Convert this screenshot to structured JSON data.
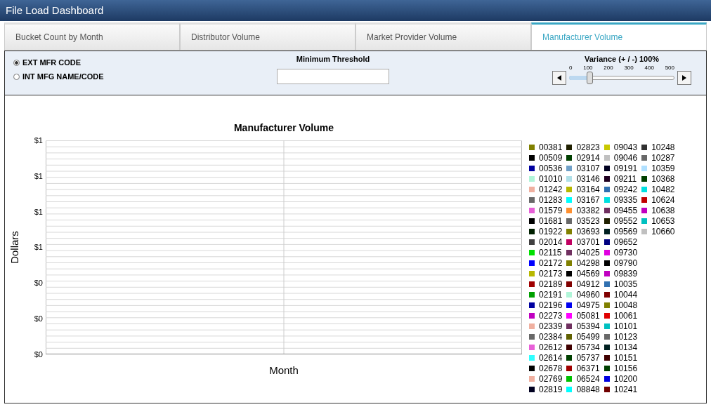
{
  "window": {
    "title": "File Load Dashboard"
  },
  "tabs": [
    {
      "label": "Bucket Count by Month",
      "selected": false
    },
    {
      "label": "Distributor Volume",
      "selected": false
    },
    {
      "label": "Market Provider Volume",
      "selected": false
    },
    {
      "label": "Manufacturer Volume",
      "selected": true
    }
  ],
  "options": [
    {
      "label": "EXT MFR CODE",
      "selected": true
    },
    {
      "label": "INT MFG NAME/CODE",
      "selected": false
    }
  ],
  "threshold": {
    "label": "Minimum Threshold"
  },
  "variance": {
    "label": "Variance (+ / -) 100%",
    "ticks": [
      "0",
      "100",
      "200",
      "300",
      "400",
      "500"
    ],
    "level": 0.2
  },
  "chart": {
    "title": "Manufacturer Volume",
    "xlabel": "Month",
    "ylabel": "Dollars",
    "ytick_labels": [
      "$1",
      "$1",
      "$1",
      "$1",
      "$0",
      "$0",
      "$0"
    ],
    "legend": [
      {
        "label": "00381",
        "color": "#808000"
      },
      {
        "label": "00509",
        "color": "#000000"
      },
      {
        "label": "00536",
        "color": "#0000a0"
      },
      {
        "label": "01010",
        "color": "#b0f5d8"
      },
      {
        "label": "01242",
        "color": "#f0b0a0"
      },
      {
        "label": "01283",
        "color": "#686868"
      },
      {
        "label": "01579",
        "color": "#e860d8"
      },
      {
        "label": "01681",
        "color": "#000000"
      },
      {
        "label": "01922",
        "color": "#002000"
      },
      {
        "label": "02014",
        "color": "#404040"
      },
      {
        "label": "02115",
        "color": "#00e000"
      },
      {
        "label": "02172",
        "color": "#0000ff"
      },
      {
        "label": "02173",
        "color": "#b8b800"
      },
      {
        "label": "02189",
        "color": "#a00000"
      },
      {
        "label": "02191",
        "color": "#00a000"
      },
      {
        "label": "02196",
        "color": "#0000a0"
      },
      {
        "label": "02273",
        "color": "#c000c0"
      },
      {
        "label": "02339",
        "color": "#f0b0a0"
      },
      {
        "label": "02384",
        "color": "#686868"
      },
      {
        "label": "02612",
        "color": "#e860d8"
      },
      {
        "label": "02614",
        "color": "#30ffff"
      },
      {
        "label": "02678",
        "color": "#000000"
      },
      {
        "label": "02769",
        "color": "#f0b0a0"
      },
      {
        "label": "02819",
        "color": "#000020"
      },
      {
        "label": "02823",
        "color": "#202000"
      },
      {
        "label": "02914",
        "color": "#004000"
      },
      {
        "label": "03107",
        "color": "#70a0c8"
      },
      {
        "label": "03146",
        "color": "#b0e0e8"
      },
      {
        "label": "03164",
        "color": "#b8b800"
      },
      {
        "label": "03167",
        "color": "#00ffff"
      },
      {
        "label": "03382",
        "color": "#ff9030"
      },
      {
        "label": "03523",
        "color": "#686868"
      },
      {
        "label": "03693",
        "color": "#808000"
      },
      {
        "label": "03701",
        "color": "#c00060"
      },
      {
        "label": "04025",
        "color": "#703060"
      },
      {
        "label": "04298",
        "color": "#808000"
      },
      {
        "label": "04569",
        "color": "#000000"
      },
      {
        "label": "04912",
        "color": "#800000"
      },
      {
        "label": "04960",
        "color": "#b0f5d8"
      },
      {
        "label": "04975",
        "color": "#0000f0"
      },
      {
        "label": "05081",
        "color": "#ff00ff"
      },
      {
        "label": "05394",
        "color": "#703060"
      },
      {
        "label": "05499",
        "color": "#606000"
      },
      {
        "label": "05734",
        "color": "#400000"
      },
      {
        "label": "05737",
        "color": "#004000"
      },
      {
        "label": "06371",
        "color": "#a00000"
      },
      {
        "label": "06524",
        "color": "#00c000"
      },
      {
        "label": "08848",
        "color": "#00ffff"
      },
      {
        "label": "09043",
        "color": "#c8c800"
      },
      {
        "label": "09046",
        "color": "#c0c0c0"
      },
      {
        "label": "09191",
        "color": "#000020"
      },
      {
        "label": "09211",
        "color": "#200020"
      },
      {
        "label": "09242",
        "color": "#3070b0"
      },
      {
        "label": "09335",
        "color": "#00e0e0"
      },
      {
        "label": "09455",
        "color": "#703060"
      },
      {
        "label": "09552",
        "color": "#202000"
      },
      {
        "label": "09569",
        "color": "#002020"
      },
      {
        "label": "09652",
        "color": "#000080"
      },
      {
        "label": "09730",
        "color": "#e000e0"
      },
      {
        "label": "09790",
        "color": "#000000"
      },
      {
        "label": "09839",
        "color": "#c000c0"
      },
      {
        "label": "10035",
        "color": "#3070b0"
      },
      {
        "label": "10044",
        "color": "#800000"
      },
      {
        "label": "10048",
        "color": "#808000"
      },
      {
        "label": "10061",
        "color": "#e00000"
      },
      {
        "label": "10101",
        "color": "#00c0c0"
      },
      {
        "label": "10123",
        "color": "#686868"
      },
      {
        "label": "10134",
        "color": "#002020"
      },
      {
        "label": "10151",
        "color": "#400000"
      },
      {
        "label": "10156",
        "color": "#004000"
      },
      {
        "label": "10200",
        "color": "#0000e0"
      },
      {
        "label": "10241",
        "color": "#700000"
      },
      {
        "label": "10248",
        "color": "#303030"
      },
      {
        "label": "10287",
        "color": "#686868"
      },
      {
        "label": "10359",
        "color": "#b0e0ff"
      },
      {
        "label": "10368",
        "color": "#004000"
      },
      {
        "label": "10482",
        "color": "#00e0e0"
      },
      {
        "label": "10624",
        "color": "#c00000"
      },
      {
        "label": "10638",
        "color": "#c000c0"
      },
      {
        "label": "10653",
        "color": "#00c0c0"
      },
      {
        "label": "10660",
        "color": "#c0c0c0"
      }
    ]
  }
}
